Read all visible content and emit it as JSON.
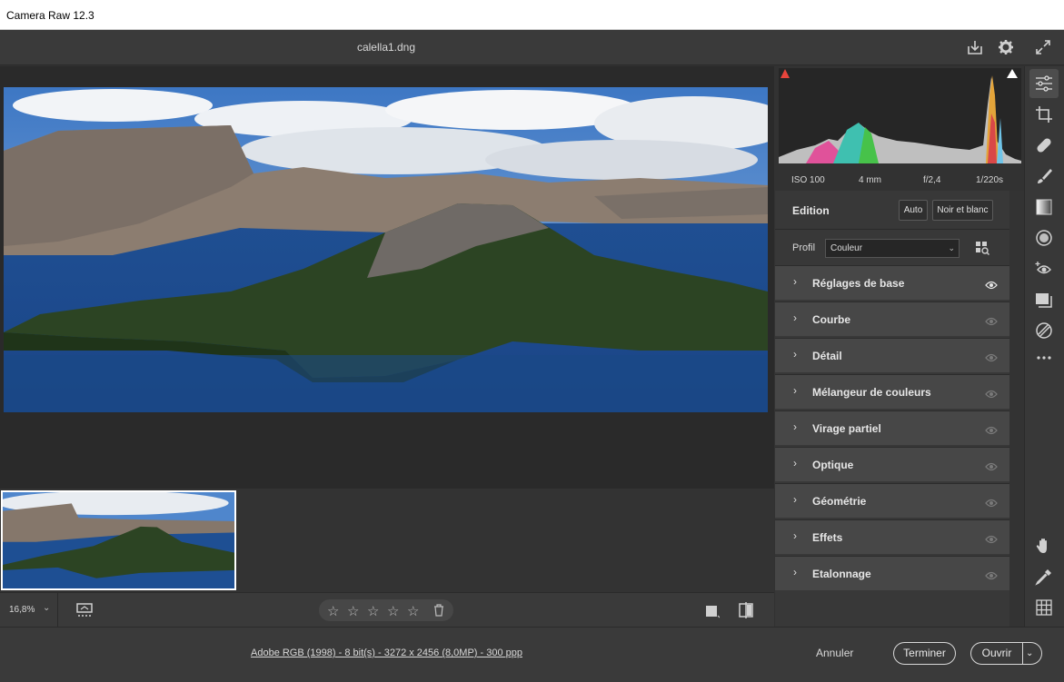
{
  "window": {
    "title": "Camera Raw 12.3"
  },
  "topbar": {
    "filename": "calella1.dng"
  },
  "histogram": {
    "iso": "ISO 100",
    "focal": "4 mm",
    "aperture": "f/2,4",
    "shutter": "1/220s"
  },
  "edit": {
    "title": "Edition",
    "auto_label": "Auto",
    "bw_label": "Noir et blanc",
    "profile_label": "Profil",
    "profile_value": "Couleur",
    "sections": [
      {
        "label": "Réglages de base",
        "eye_active": true
      },
      {
        "label": "Courbe",
        "eye_active": false
      },
      {
        "label": "Détail",
        "eye_active": false
      },
      {
        "label": "Mélangeur de couleurs",
        "eye_active": false
      },
      {
        "label": "Virage partiel",
        "eye_active": false
      },
      {
        "label": "Optique",
        "eye_active": false
      },
      {
        "label": "Géométrie",
        "eye_active": false
      },
      {
        "label": "Effets",
        "eye_active": false
      },
      {
        "label": "Etalonnage",
        "eye_active": false
      }
    ]
  },
  "bottombar": {
    "zoom": "16,8%",
    "stars": 5
  },
  "footer": {
    "info": "Adobe RGB (1998) - 8 bit(s) - 3272 x 2456 (8,0MP) - 300 ppp",
    "cancel": "Annuler",
    "done": "Terminer",
    "open": "Ouvrir"
  },
  "colors": {
    "panel_bg": "#383838",
    "section_bg": "#474747",
    "canvas_bg": "#2a2a2a",
    "lake_blue": "#1d4f8f"
  }
}
